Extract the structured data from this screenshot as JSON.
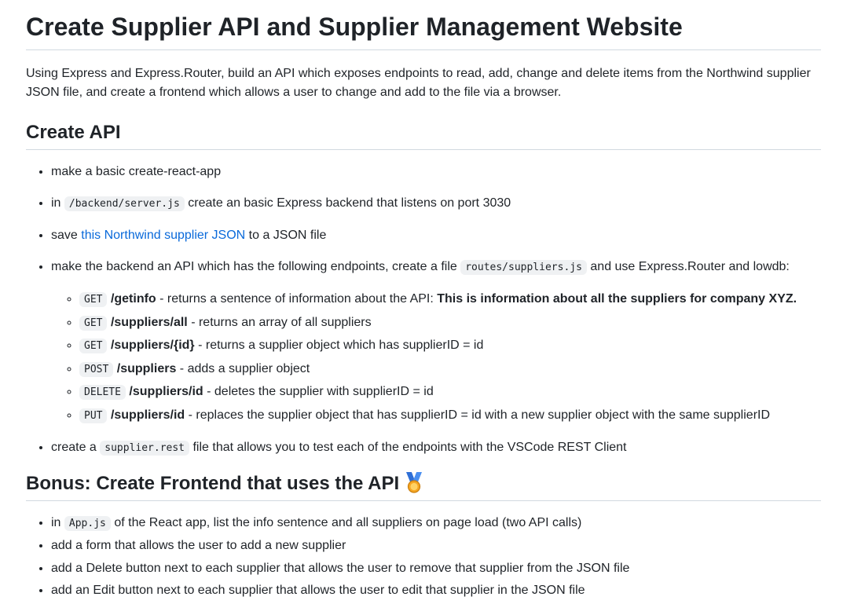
{
  "title": "Create Supplier API and Supplier Management Website",
  "intro": "Using Express and Express.Router, build an API which exposes endpoints to read, add, change and delete items from the Northwind supplier JSON file, and create a frontend which allows a user to change and add to the file via a browser.",
  "create_api": {
    "heading": "Create API",
    "items": {
      "basic_app": "make a basic create-react-app",
      "server_prefix": "in",
      "server_code": "/backend/server.js",
      "server_suffix": "create an basic Express backend that listens on port 3030",
      "save_prefix": "save",
      "save_link": "this Northwind supplier JSON",
      "save_suffix": "to a JSON file",
      "endpoints_prefix": "make the backend an API which has the following endpoints, create a file",
      "endpoints_code": "routes/suppliers.js",
      "endpoints_suffix": "and use Express.Router and lowdb:",
      "rest_prefix": "create a",
      "rest_code": "supplier.rest",
      "rest_suffix": "file that allows you to test each of the endpoints with the VSCode REST Client"
    },
    "endpoints": [
      {
        "method": "GET",
        "path": "/getinfo",
        "desc": " - returns a sentence of information about the API: ",
        "bold_tail": "This is information about all the suppliers for company XYZ."
      },
      {
        "method": "GET",
        "path": "/suppliers/all",
        "desc": " - returns an array of all suppliers",
        "bold_tail": ""
      },
      {
        "method": "GET",
        "path": "/suppliers/{id}",
        "desc": " - returns a supplier object which has supplierID = id",
        "bold_tail": ""
      },
      {
        "method": "POST",
        "path": "/suppliers",
        "desc": " - adds a supplier object",
        "bold_tail": ""
      },
      {
        "method": "DELETE",
        "path": "/suppliers/id",
        "desc": " - deletes the supplier with supplierID = id",
        "bold_tail": ""
      },
      {
        "method": "PUT",
        "path": "/suppliers/id",
        "desc": " - replaces the supplier object that has supplierID = id with a new supplier object with the same supplierID",
        "bold_tail": ""
      }
    ]
  },
  "bonus": {
    "heading": "Bonus: Create Frontend that uses the API",
    "icon": "medal-icon",
    "items": {
      "app_prefix": "in",
      "app_code": "App.js",
      "app_suffix": "of the React app, list the info sentence and all suppliers on page load (two API calls)",
      "form": "add a form that allows the user to add a new supplier",
      "delete": "add a Delete button next to each supplier that allows the user to remove that supplier from the JSON file",
      "edit": "add an Edit button next to each supplier that allows the user to edit that supplier in the JSON file"
    }
  },
  "colors": {
    "text": "#1f2328",
    "link": "#0969da",
    "code_bg": "#eff1f3",
    "rule": "#d1d9e0"
  }
}
